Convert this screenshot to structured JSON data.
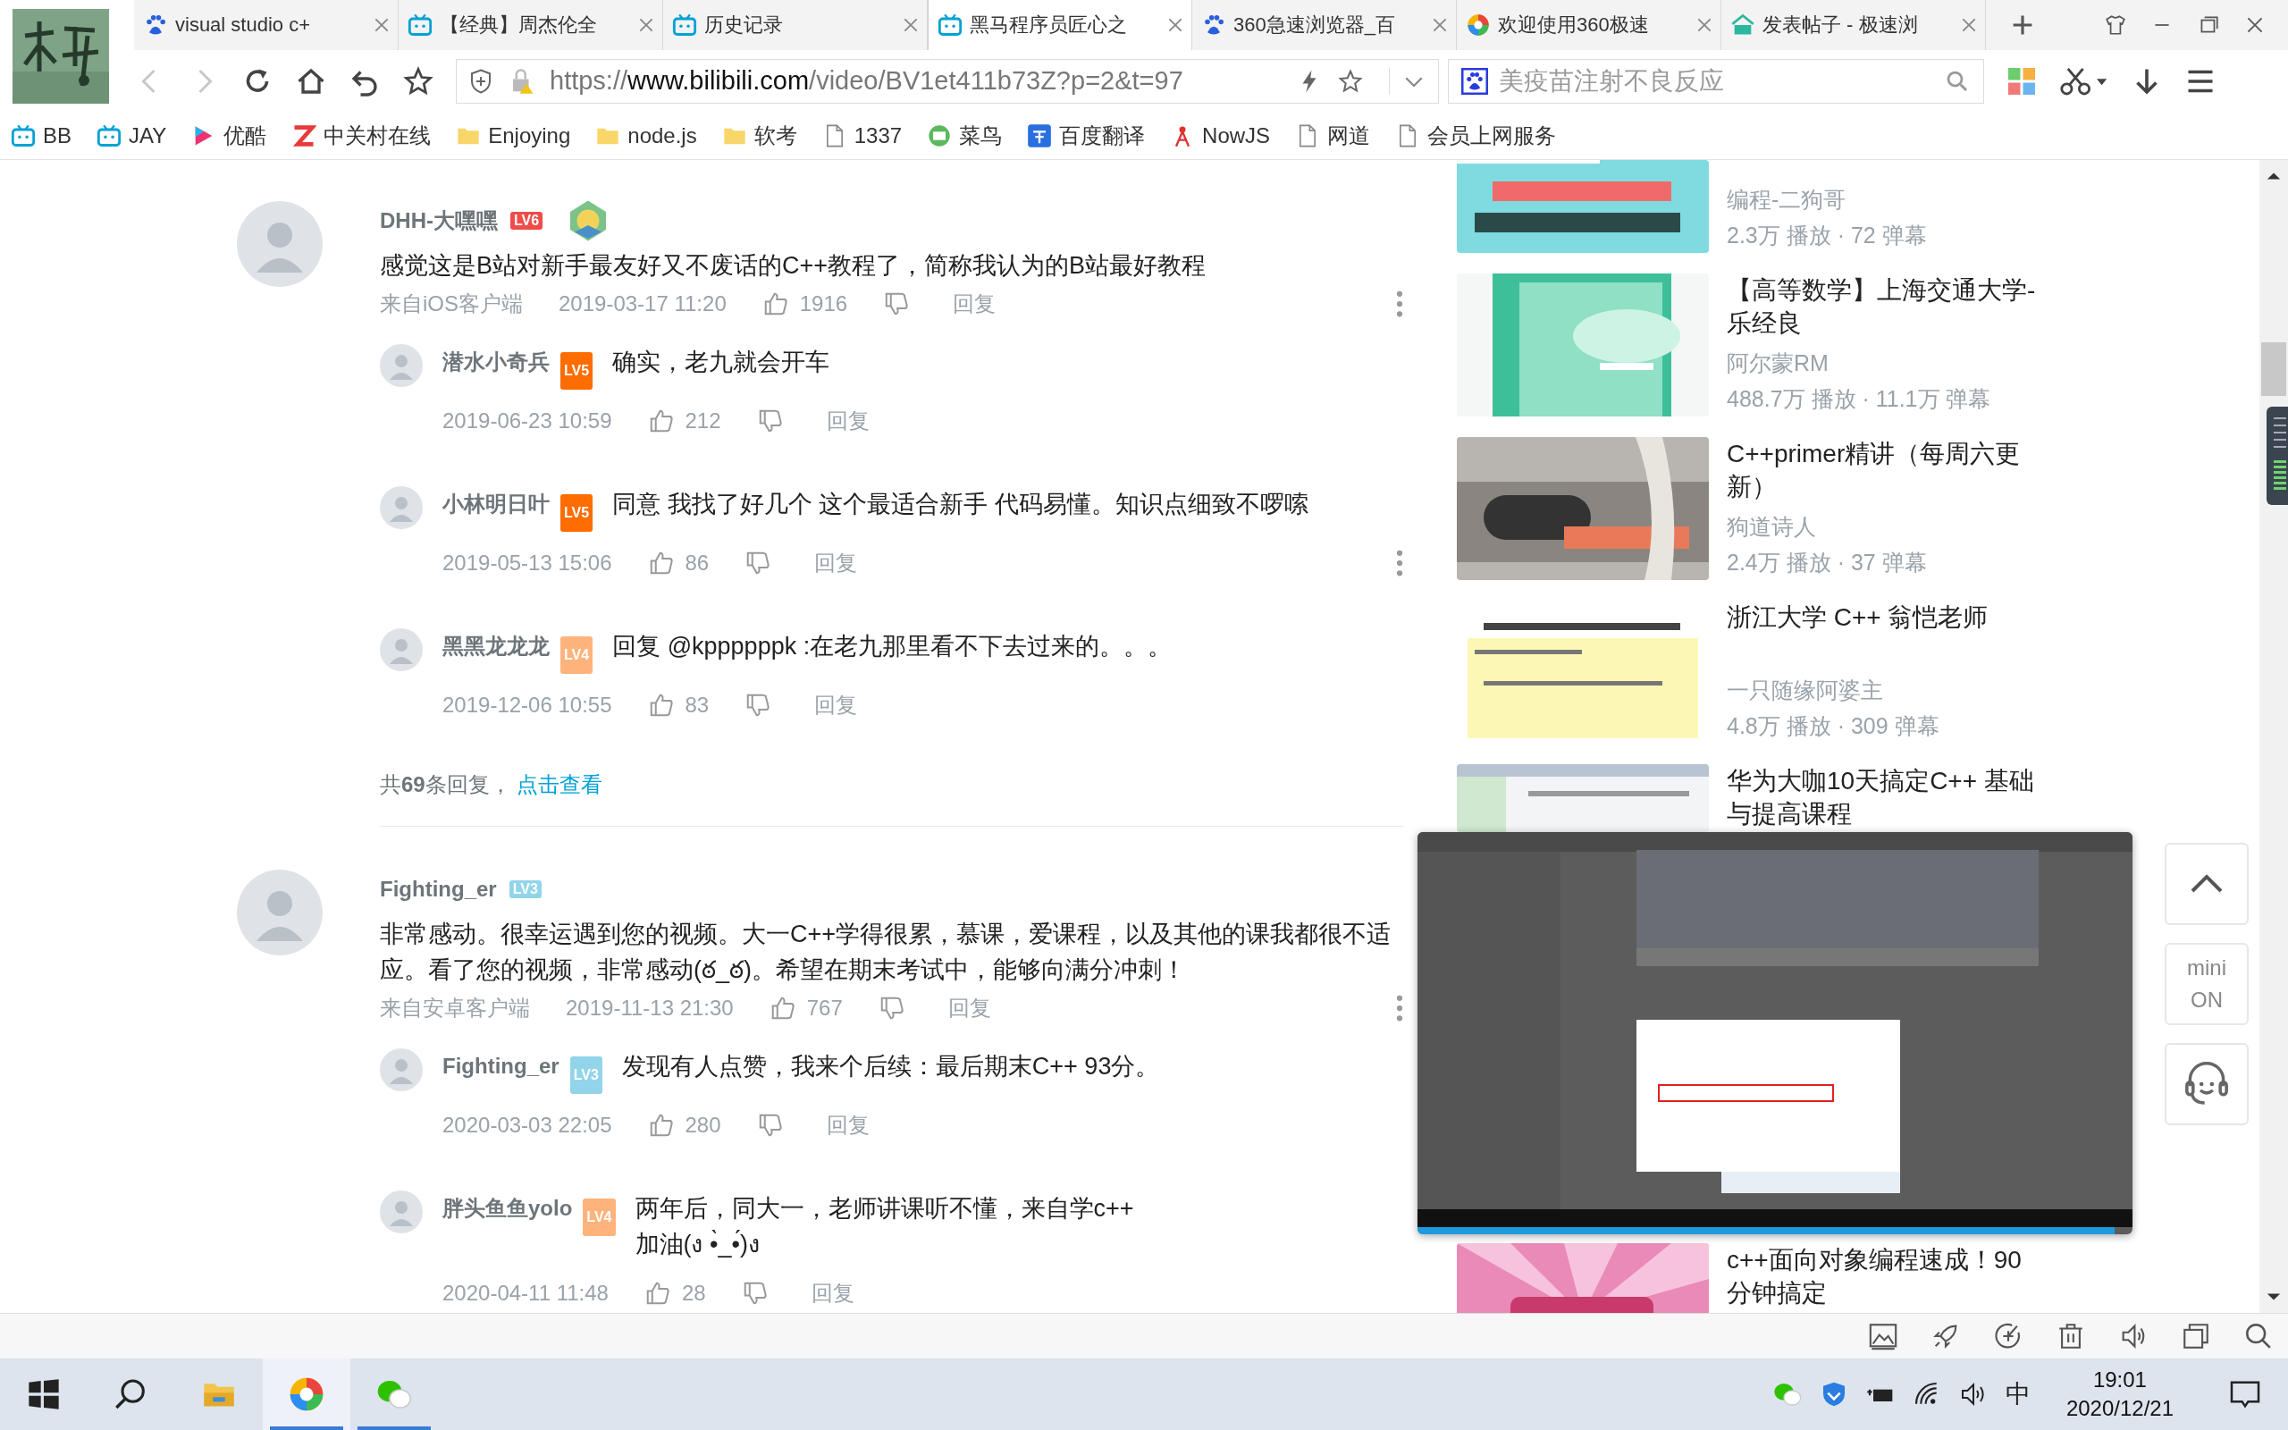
{
  "tabs": [
    {
      "title": "visual studio c+",
      "selected": false
    },
    {
      "title": "【经典】周杰伦全",
      "selected": false
    },
    {
      "title": "历史记录",
      "selected": false
    },
    {
      "title": "黑马程序员匠心之",
      "selected": true
    },
    {
      "title": "360急速浏览器_百",
      "selected": false
    },
    {
      "title": "欢迎使用360极速",
      "selected": false
    },
    {
      "title": "发表帖子 - 极速浏",
      "selected": false
    }
  ],
  "address": {
    "scheme": "https://",
    "host": "www.bilibili.com",
    "path": "/video/BV1et411b73Z?p=2&t=97"
  },
  "search": {
    "placeholder": "美疫苗注射不良反应"
  },
  "bookmarks": [
    {
      "label": "BB"
    },
    {
      "label": "JAY"
    },
    {
      "label": "优酷"
    },
    {
      "label": "中关村在线"
    },
    {
      "label": "Enjoying"
    },
    {
      "label": "node.js"
    },
    {
      "label": "软考"
    },
    {
      "label": "1337"
    },
    {
      "label": "菜鸟"
    },
    {
      "label": "百度翻译"
    },
    {
      "label": "NowJS"
    },
    {
      "label": "网道"
    },
    {
      "label": "会员上网服务"
    }
  ],
  "comments": [
    {
      "user": "DHH-大嘿嘿",
      "level": "LV6",
      "color": "#f04c49",
      "pendant": true,
      "text": "感觉这是B站对新手最友好又不废话的C++教程了，简称我认为的B站最好教程",
      "source": "来自iOS客户端",
      "time": "2019-03-17 11:20",
      "likes": "1916",
      "reply": "回复",
      "menu": true,
      "replies": [
        {
          "user": "潜水小奇兵",
          "level": "LV5",
          "color": "#ff6c00",
          "text": "确实，老九就会开车",
          "time": "2019-06-23 10:59",
          "likes": "212",
          "reply": "回复",
          "menu": false
        },
        {
          "user": "小林明日叶",
          "level": "LV5",
          "color": "#ff6c00",
          "text": "同意 我找了好几个 这个最适合新手 代码易懂。知识点细致不啰嗦",
          "time": "2019-05-13 15:06",
          "likes": "86",
          "reply": "回复",
          "menu": true
        },
        {
          "user": "黑黑龙龙龙",
          "level": "LV4",
          "color": "#ffb37c",
          "text": "回复 @kppppppk :在老九那里看不下去过来的。。。",
          "time": "2019-12-06 10:55",
          "likes": "83",
          "reply": "回复",
          "menu": false
        }
      ],
      "footer": {
        "count": "共**69**条回复，",
        "link": "点击查看"
      }
    },
    {
      "user": "Fighting_er",
      "level": "LV3",
      "color": "#92d4ea",
      "pendant": false,
      "text": "非常感动。很幸运遇到您的视频。大一C++学得很累，慕课，爱课程，以及其他的课我都很不适应。看了您的视频，非常感动(ఠ_ఠ)。希望在期末考试中，能够向满分冲刺！",
      "source": "来自安卓客户端",
      "time": "2019-11-13 21:30",
      "likes": "767",
      "reply": "回复",
      "menu": true,
      "replies": [
        {
          "user": "Fighting_er",
          "level": "LV3",
          "color": "#92d4ea",
          "text": "发现有人点赞，我来个后续：最后期末C++ 93分。",
          "time": "2020-03-03 22:05",
          "likes": "280",
          "reply": "回复",
          "menu": false
        },
        {
          "user": "胖头鱼鱼yolo",
          "level": "LV4",
          "color": "#ffb37c",
          "text": "两年后，同大一，老师讲课听不懂，来自学c++\n加油(ง •̀_•́)ง",
          "time": "2020-04-11 11:48",
          "likes": "28",
          "reply": "回复",
          "menu": false
        }
      ]
    }
  ],
  "videos": [
    {
      "author": "编程-二狗哥",
      "stats": "2.3万 播放 · 72 弹幕"
    },
    {
      "title": "【高等数学】上海交通大学-乐经良",
      "author": "阿尔蒙RM",
      "stats": "488.7万 播放 · 11.1万 弹幕"
    },
    {
      "title": "C++primer精讲（每周六更新）",
      "author": "狗道诗人",
      "stats": "2.4万 播放 · 37 弹幕"
    },
    {
      "title": "浙江大学 C++ 翁恺老师",
      "author": "一只随缘阿婆主",
      "stats": "4.8万 播放 · 309 弹幕"
    },
    {
      "title": "华为大咖10天搞定C++ 基础与提高课程"
    },
    {
      "title": "c++面向对象编程速成！90 分钟搞定"
    }
  ],
  "mini_button": {
    "label": "mini ON"
  },
  "taskbar": {
    "apps": [
      {
        "selected": false,
        "running": false
      },
      {
        "selected": true,
        "running": true
      },
      {
        "selected": false,
        "running": true
      }
    ],
    "ime": "中",
    "time": "19:01",
    "date": "2020/12/21"
  }
}
